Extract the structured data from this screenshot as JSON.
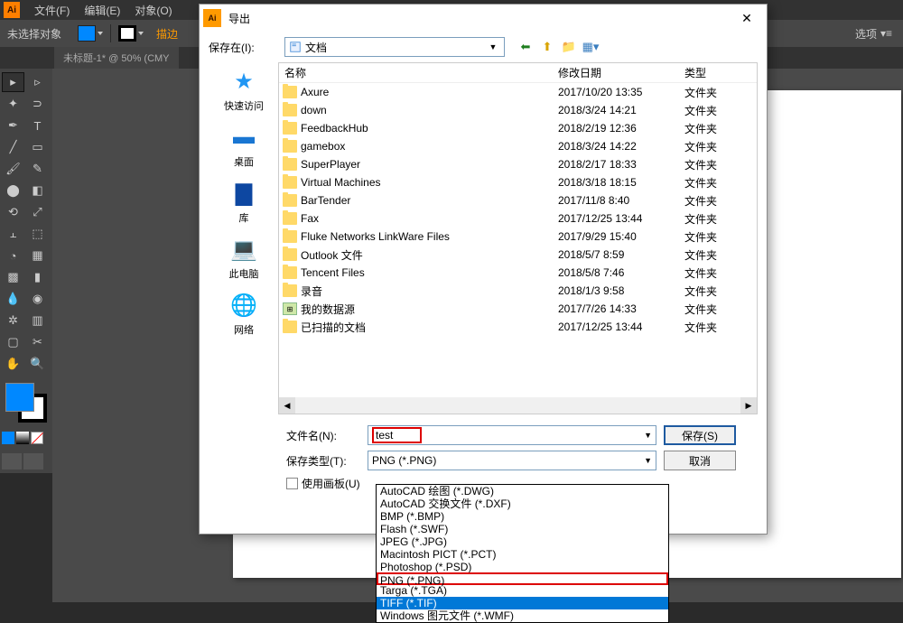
{
  "app": {
    "menu": [
      "文件(F)",
      "编辑(E)",
      "对象(O)"
    ],
    "no_selection": "未选择对象",
    "tab_title": "未标题-1* @ 50% (CMY",
    "right_control": "选项",
    "truncated": "描边"
  },
  "dialog": {
    "title": "导出",
    "save_in_label": "保存在(I):",
    "save_in_value": "文档",
    "columns": {
      "name": "名称",
      "date": "修改日期",
      "type": "类型"
    },
    "places": [
      {
        "label": "快速访问",
        "color": "#2196f3",
        "glyph": "★"
      },
      {
        "label": "桌面",
        "color": "#1976d2",
        "glyph": "▬"
      },
      {
        "label": "库",
        "color": "#0d47a1",
        "glyph": "▇"
      },
      {
        "label": "此电脑",
        "color": "#607d8b",
        "glyph": "💻"
      },
      {
        "label": "网络",
        "color": "#2196f3",
        "glyph": "🌐"
      }
    ],
    "files": [
      {
        "name": "Axure",
        "date": "2017/10/20 13:35",
        "type": "文件夹",
        "icon": "folder"
      },
      {
        "name": "down",
        "date": "2018/3/24 14:21",
        "type": "文件夹",
        "icon": "folder"
      },
      {
        "name": "FeedbackHub",
        "date": "2018/2/19 12:36",
        "type": "文件夹",
        "icon": "folder"
      },
      {
        "name": "gamebox",
        "date": "2018/3/24 14:22",
        "type": "文件夹",
        "icon": "folder"
      },
      {
        "name": "SuperPlayer",
        "date": "2018/2/17 18:33",
        "type": "文件夹",
        "icon": "folder"
      },
      {
        "name": "Virtual Machines",
        "date": "2018/3/18 18:15",
        "type": "文件夹",
        "icon": "folder"
      },
      {
        "name": "BarTender",
        "date": "2017/11/8 8:40",
        "type": "文件夹",
        "icon": "folder"
      },
      {
        "name": "Fax",
        "date": "2017/12/25 13:44",
        "type": "文件夹",
        "icon": "folder"
      },
      {
        "name": "Fluke Networks LinkWare Files",
        "date": "2017/9/29 15:40",
        "type": "文件夹",
        "icon": "folder"
      },
      {
        "name": "Outlook 文件",
        "date": "2018/5/7 8:59",
        "type": "文件夹",
        "icon": "folder"
      },
      {
        "name": "Tencent Files",
        "date": "2018/5/8 7:46",
        "type": "文件夹",
        "icon": "folder"
      },
      {
        "name": "录音",
        "date": "2018/1/3 9:58",
        "type": "文件夹",
        "icon": "folder"
      },
      {
        "name": "我的数据源",
        "date": "2017/7/26 14:33",
        "type": "文件夹",
        "icon": "special"
      },
      {
        "name": "已扫描的文档",
        "date": "2017/12/25 13:44",
        "type": "文件夹",
        "icon": "folder"
      }
    ],
    "filename_label": "文件名(N):",
    "filename_value": "test",
    "filetype_label": "保存类型(T):",
    "filetype_value": "PNG (*.PNG)",
    "use_artboards": "使用画板(U)",
    "save_btn": "保存(S)",
    "cancel_btn": "取消",
    "formats": [
      {
        "label": "AutoCAD 绘图 (*.DWG)"
      },
      {
        "label": "AutoCAD 交换文件 (*.DXF)"
      },
      {
        "label": "BMP (*.BMP)"
      },
      {
        "label": "Flash (*.SWF)"
      },
      {
        "label": "JPEG (*.JPG)"
      },
      {
        "label": "Macintosh PICT (*.PCT)"
      },
      {
        "label": "Photoshop (*.PSD)"
      },
      {
        "label": "PNG (*.PNG)",
        "highlight": true
      },
      {
        "label": "Targa (*.TGA)"
      },
      {
        "label": "TIFF (*.TIF)",
        "selected": true
      },
      {
        "label": "Windows 图元文件 (*.WMF)"
      }
    ]
  }
}
